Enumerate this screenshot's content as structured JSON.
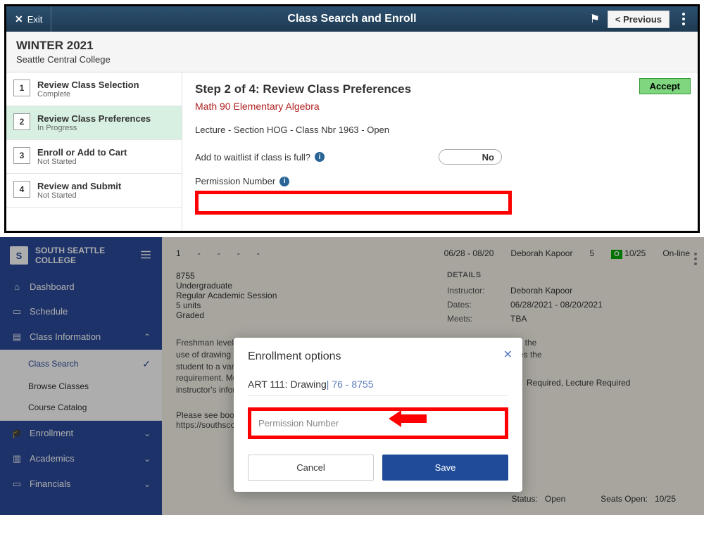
{
  "panel1": {
    "topbar": {
      "exit_label": "Exit",
      "title": "Class Search and Enroll",
      "previous_label": "< Previous"
    },
    "term": "WINTER 2021",
    "college": "Seattle Central College",
    "steps": [
      {
        "num": "1",
        "title": "Review Class Selection",
        "status": "Complete"
      },
      {
        "num": "2",
        "title": "Review Class Preferences",
        "status": "In Progress"
      },
      {
        "num": "3",
        "title": "Enroll or Add to Cart",
        "status": "Not Started"
      },
      {
        "num": "4",
        "title": "Review and Submit",
        "status": "Not Started"
      }
    ],
    "content": {
      "heading": "Step 2 of 4: Review Class Preferences",
      "course": "Math 90  Elementary Algebra",
      "section_line": "Lecture - Section HOG - Class Nbr 1963 - Open",
      "waitlist_label": "Add to waitlist if class is full?",
      "waitlist_value": "No",
      "perm_label": "Permission Number",
      "accept_label": "Accept"
    }
  },
  "panel2": {
    "college": {
      "name_line1": "SOUTH SEATTLE",
      "name_line2": "COLLEGE",
      "logo_letter": "S"
    },
    "nav": {
      "dashboard": "Dashboard",
      "schedule": "Schedule",
      "class_info": "Class Information",
      "class_search": "Class Search",
      "browse": "Browse Classes",
      "catalog": "Course Catalog",
      "enrollment": "Enrollment",
      "academics": "Academics",
      "financials": "Financials"
    },
    "row": {
      "num": "1",
      "d1": "-",
      "d2": "-",
      "d3": "-",
      "d4": "-",
      "dates": "06/28 - 08/20",
      "instructor": "Deborah Kapoor",
      "units": "5",
      "status_icon": "O",
      "seats": "10/25",
      "mode": "On-line"
    },
    "details": {
      "header": "DETAILS",
      "class_nbr": "8755",
      "career": "Undergraduate",
      "session": "Regular Academic Session",
      "units": "5 units",
      "grading": "Graded",
      "instructor_label": "Instructor:",
      "instructor": "Deborah Kapoor",
      "dates_label": "Dates:",
      "dates": "06/28/2021 - 08/20/2021",
      "meets_label": "Meets:",
      "meets": "TBA"
    },
    "desc": "Freshman level drawing course to develop perception of form, space, light and value through the use of drawing media. It introduces key concepts of perspective and composition and exposes the student to a variety of drawing media. It fulfills the Visual, Literary and Performing Arts requirement. More specific information about this section may be found by looking up your instructor's information at https://people.sea...",
    "reqs": "Required, Lecture Required",
    "booknote_l1": "Please see bookstore website",
    "booknote_l2": "https://southscc.bncollege.com/shop/southseattle-",
    "status_pair": {
      "k": "Status:",
      "v": "Open"
    },
    "seats_pair": {
      "k": "Seats Open:",
      "v": "10/25"
    },
    "modal": {
      "title": "Enrollment options",
      "course_prefix": "ART 111: Drawing",
      "course_suffix": "| 76 - 8755",
      "perm_placeholder": "Permission Number",
      "cancel": "Cancel",
      "save": "Save"
    }
  }
}
